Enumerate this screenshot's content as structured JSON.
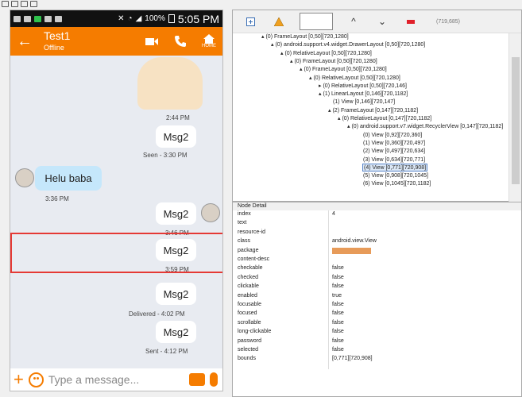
{
  "colors": {
    "accent": "#f57c00",
    "incoming_bubble": "#c5e7fb",
    "outgoing_bubble": "#ffffff",
    "selection_border": "#e53935",
    "package_highlight": "#e79b59"
  },
  "status_bar": {
    "battery": "100%",
    "time": "5:05 PM"
  },
  "chat": {
    "name": "Test1",
    "status": "Offline",
    "home_label": "HOME",
    "messages": [
      {
        "type": "sticker",
        "time": "2:44 PM"
      },
      {
        "type": "out",
        "text": "Msg2",
        "time": "Seen - 3:30 PM"
      },
      {
        "type": "in",
        "text": "Helu baba",
        "time": "3:36 PM"
      },
      {
        "type": "out",
        "text": "Msg2",
        "time": "3:46 PM"
      },
      {
        "type": "out",
        "text": "Msg2",
        "time": "3:59 PM"
      },
      {
        "type": "out",
        "text": "Msg2",
        "time": "Delivered - 4:02 PM"
      },
      {
        "type": "out",
        "text": "Msg2",
        "time": "Sent - 4:12 PM"
      }
    ],
    "input_placeholder": "Type a message..."
  },
  "hierarchy": {
    "coords_readout": "(719,685)",
    "rows": [
      {
        "label": "(0) FrameLayout [0,50][720,1280]"
      },
      {
        "label": "(0) android.support.v4.widget.DrawerLayout [0,50][720,1280]"
      },
      {
        "label": "(0) RelativeLayout [0,50][720,1280]"
      },
      {
        "label": "(0) FrameLayout [0,50][720,1280]"
      },
      {
        "label": "(0) FrameLayout [0,50][720,1280]"
      },
      {
        "label": "(0) RelativeLayout [0,50][720,1280]"
      },
      {
        "label": "(0) RelativeLayout [0,50][720,146]"
      },
      {
        "label": "(1) LinearLayout [0,146][720,1182]"
      },
      {
        "label": "(1) View [0,146][720,147]"
      },
      {
        "label": "(2) FrameLayout [0,147][720,1182]"
      },
      {
        "label": "(0) RelativeLayout [0,147][720,1182]"
      },
      {
        "label": "(0) android.support.v7.widget.RecyclerView [0,147][720,1182]"
      },
      {
        "label": "(0) View [0,92][720,360]"
      },
      {
        "label": "(1) View [0,360][720,497]"
      },
      {
        "label": "(2) View [0,497][720,634]"
      },
      {
        "label": "(3) View [0,634][720,771]"
      },
      {
        "label": "(4) View [0,771][720,908]"
      },
      {
        "label": "(5) View [0,908][720,1045]"
      },
      {
        "label": "(6) View [0,1045][720,1182]"
      }
    ]
  },
  "node_detail": {
    "title": "Node Detail",
    "props": [
      {
        "key": "index",
        "value": "4"
      },
      {
        "key": "text",
        "value": ""
      },
      {
        "key": "resource-id",
        "value": ""
      },
      {
        "key": "class",
        "value": "android.view.View"
      },
      {
        "key": "package",
        "value": ""
      },
      {
        "key": "content-desc",
        "value": ""
      },
      {
        "key": "checkable",
        "value": "false"
      },
      {
        "key": "checked",
        "value": "false"
      },
      {
        "key": "clickable",
        "value": "false"
      },
      {
        "key": "enabled",
        "value": "true"
      },
      {
        "key": "focusable",
        "value": "false"
      },
      {
        "key": "focused",
        "value": "false"
      },
      {
        "key": "scrollable",
        "value": "false"
      },
      {
        "key": "long-clickable",
        "value": "false"
      },
      {
        "key": "password",
        "value": "false"
      },
      {
        "key": "selected",
        "value": "false"
      },
      {
        "key": "bounds",
        "value": "[0,771][720,908]"
      }
    ]
  }
}
